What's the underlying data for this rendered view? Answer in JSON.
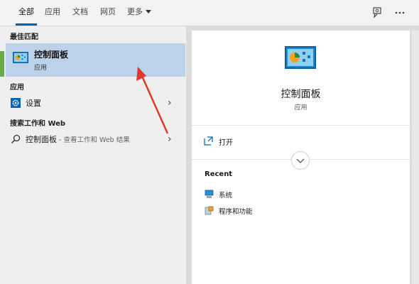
{
  "tabs": {
    "all": "全部",
    "apps": "应用",
    "documents": "文档",
    "web": "网页",
    "more": "更多"
  },
  "topbar": {
    "feedback_icon": "feedback-icon",
    "more_icon": "ellipsis-icon"
  },
  "left": {
    "best_match_header": "最佳匹配",
    "best_match": {
      "title": "控制面板",
      "subtitle": "应用",
      "icon": "control-panel-icon"
    },
    "apps_header": "应用",
    "apps_items": [
      {
        "label": "设置",
        "icon": "settings-gear-icon"
      }
    ],
    "web_header": "搜索工作和 Web",
    "web_items": [
      {
        "label": "控制面板",
        "suffix": " - 查看工作和 Web 结果",
        "icon": "search-icon"
      }
    ]
  },
  "right": {
    "title": "控制面板",
    "subtitle": "应用",
    "icon": "control-panel-icon",
    "actions": [
      {
        "label": "打开",
        "icon": "open-icon"
      }
    ],
    "recent_header": "Recent",
    "recent_items": [
      {
        "label": "系统",
        "icon": "system-icon"
      },
      {
        "label": "程序和功能",
        "icon": "programs-features-icon"
      }
    ]
  },
  "colors": {
    "accent": "#0063b1",
    "selection": "#bcd2ea",
    "annotation_arrow": "#e0392b"
  }
}
